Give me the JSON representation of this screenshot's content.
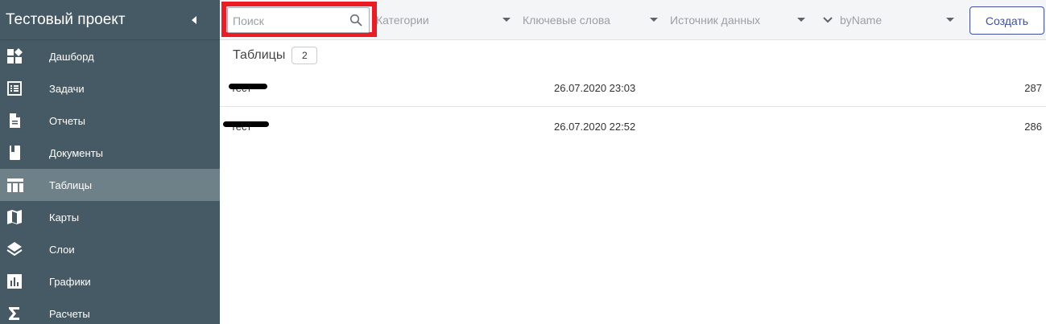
{
  "sidebar": {
    "title": "Тестовый проект",
    "collapse_icon": "triangle-left-icon",
    "items": [
      {
        "label": "Дашборд",
        "icon": "dashboard-icon"
      },
      {
        "label": "Задачи",
        "icon": "task-list-icon"
      },
      {
        "label": "Отчеты",
        "icon": "document-icon"
      },
      {
        "label": "Документы",
        "icon": "book-icon"
      },
      {
        "label": "Таблицы",
        "icon": "table-icon",
        "active": true
      },
      {
        "label": "Карты",
        "icon": "map-icon"
      },
      {
        "label": "Слои",
        "icon": "layers-icon"
      },
      {
        "label": "Графики",
        "icon": "bar-chart-icon"
      },
      {
        "label": "Расчеты",
        "icon": "sigma-icon"
      }
    ],
    "background": "#455a64",
    "active_background": "#6e8189"
  },
  "toolbar": {
    "search_placeholder": "Поиск",
    "search_value": "",
    "filters": {
      "categories": "Категории",
      "keywords": "Ключевые слова",
      "source": "Источник данных",
      "sort": "byName"
    },
    "create_label": "Создать",
    "highlight_color": "#ed1c24"
  },
  "main": {
    "section_title": "Таблицы",
    "count": "2",
    "rows": [
      {
        "name": "тест",
        "date": "26.07.2020 23:03",
        "count": "287"
      },
      {
        "name": "тест",
        "date": "26.07.2020 22:52",
        "count": "286"
      }
    ]
  }
}
